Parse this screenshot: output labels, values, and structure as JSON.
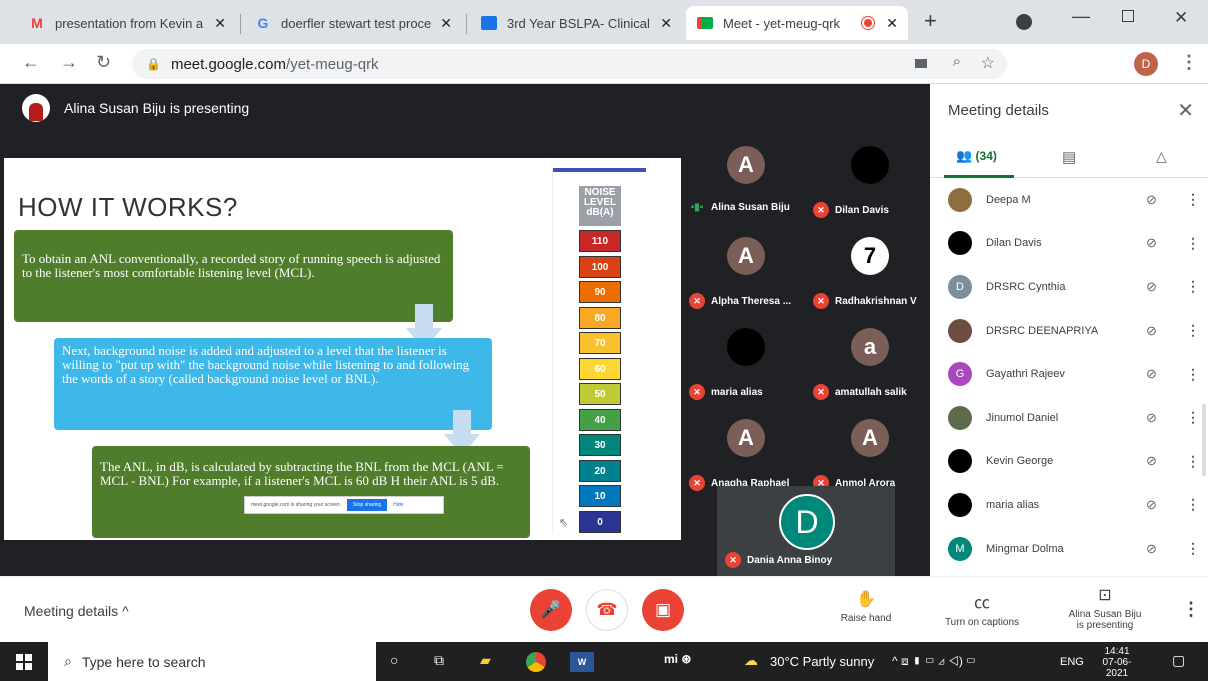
{
  "browser": {
    "tabs": [
      {
        "title": "presentation from Kevin a",
        "icon": "gmail-icon"
      },
      {
        "title": "doerfler stewart test proce",
        "icon": "google-icon"
      },
      {
        "title": "3rd Year BSLPA- Clinical P",
        "icon": "classroom-icon"
      },
      {
        "title": "Meet - yet-meug-qrk",
        "icon": "meet-icon"
      }
    ],
    "url_host": "meet.google.com",
    "url_path": "/yet-meug-qrk",
    "profile_initial": "D"
  },
  "meeting": {
    "presenter_banner": "Alina Susan Biju is presenting",
    "slide": {
      "title": "HOW IT WORKS?",
      "box1": "To obtain an ANL conventionally, a recorded story of running speech is adjusted to the listener's most comfortable listening level (MCL).",
      "box2": "Next, background noise is added and adjusted to a level that the listener is willing to \"put up with\" the background noise while listening to and following the words of a story (called background noise level or BNL).",
      "box3": "The ANL, in dB, is calculated by subtracting the BNL from the MCL (ANL = MCL - BNL) For example, if a listener's MCL is 60 dB H their ANL is 5 dB.",
      "share_text": "meet.google.com is sharing your screen.",
      "stop_sharing": "Stop sharing",
      "hide": "Hide",
      "meter_header": "NOISE LEVEL dB(A)",
      "levels": [
        "110",
        "100",
        "90",
        "80",
        "70",
        "60",
        "50",
        "40",
        "30",
        "20",
        "10",
        "0"
      ],
      "level_colors": [
        "#c62828",
        "#d84315",
        "#ef6c00",
        "#f9a825",
        "#fbc02d",
        "#fdd835",
        "#c0ca33",
        "#43a047",
        "#00897b",
        "#00838f",
        "#0277bd",
        "#283593"
      ]
    },
    "tiles": [
      {
        "name": "Alina Susan Biju",
        "speaking": true,
        "avatar": "A"
      },
      {
        "name": "Dilan Davis",
        "speaking": false,
        "avatar": ""
      },
      {
        "name": "Alpha Theresa ...",
        "speaking": false,
        "avatar": "A"
      },
      {
        "name": "Radhakrishnan V",
        "speaking": false,
        "avatar": "7"
      },
      {
        "name": "maria alias",
        "speaking": false,
        "avatar": ""
      },
      {
        "name": "amatullah salik",
        "speaking": false,
        "avatar": "a"
      },
      {
        "name": "Anagha Raphael",
        "speaking": false,
        "avatar": "A"
      },
      {
        "name": "Anmol Arora",
        "speaking": false,
        "avatar": "A"
      }
    ],
    "self_tile": {
      "name": "Dania Anna Binoy",
      "initial": "D"
    }
  },
  "panel": {
    "title": "Meeting details",
    "people_count": "(34)",
    "participants": [
      {
        "name": "Deepa M",
        "initial": "",
        "color": "#8d6e3f"
      },
      {
        "name": "Dilan Davis",
        "initial": "",
        "color": "#000000"
      },
      {
        "name": "DRSRC Cynthia",
        "initial": "D",
        "color": "#78909c"
      },
      {
        "name": "DRSRC DEENAPRIYA",
        "initial": "",
        "color": "#6d4c41"
      },
      {
        "name": "Gayathri Rajeev",
        "initial": "G",
        "color": "#ab47bc"
      },
      {
        "name": "Jinumol Daniel",
        "initial": "",
        "color": "#5d6b4a"
      },
      {
        "name": "Kevin George",
        "initial": "",
        "color": "#000000"
      },
      {
        "name": "maria alias",
        "initial": "",
        "color": "#000000"
      },
      {
        "name": "Mingmar Dolma",
        "initial": "M",
        "color": "#00897b"
      }
    ]
  },
  "controls": {
    "meeting_details": "Meeting details",
    "raise_hand": "Raise hand",
    "captions": "Turn on captions",
    "presenting_line1": "Alina Susan Biju",
    "presenting_line2": "is presenting"
  },
  "taskbar": {
    "search_placeholder": "Type here to search",
    "weather": "30°C  Partly sunny",
    "lang": "ENG",
    "time": "14:41",
    "date": "07-06-2021"
  }
}
